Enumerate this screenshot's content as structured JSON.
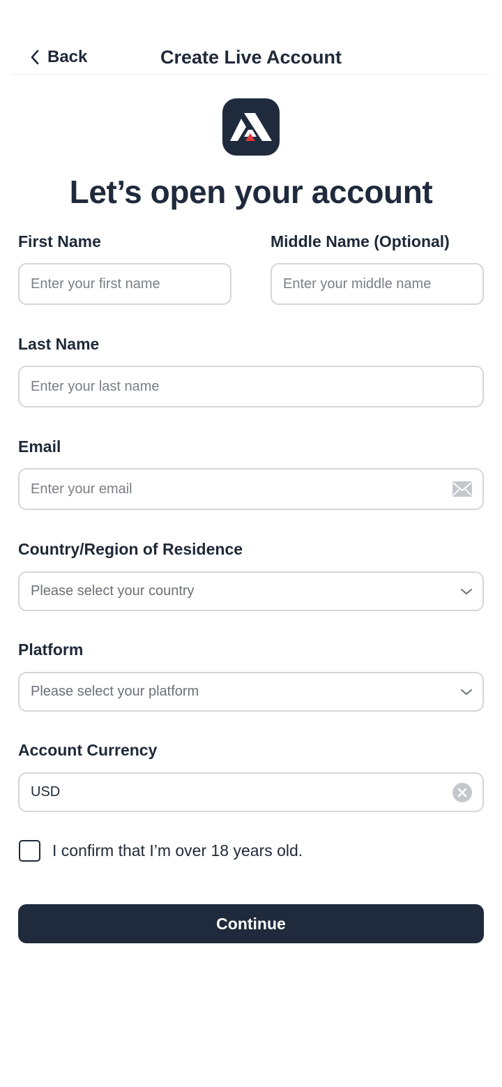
{
  "header": {
    "back_label": "Back",
    "title": "Create Live Account"
  },
  "app_icon": "triangle-logo-icon",
  "headline": "Let’s open your account",
  "form": {
    "first_name": {
      "label": "First Name",
      "placeholder": "Enter your first name"
    },
    "middle_name": {
      "label": "Middle Name (Optional)",
      "placeholder": "Enter your middle name"
    },
    "last_name": {
      "label": "Last Name",
      "placeholder": "Enter your last name"
    },
    "email": {
      "label": "Email",
      "placeholder": "Enter your email",
      "icon": "envelope-icon"
    },
    "country": {
      "label": "Country/Region of Residence",
      "placeholder": "Please select your country",
      "icon": "chevron-down-icon"
    },
    "platform": {
      "label": "Platform",
      "placeholder": "Please select your platform",
      "icon": "chevron-down-icon"
    },
    "currency": {
      "label": "Account Currency",
      "value": "USD",
      "icon": "clear-icon"
    },
    "age_confirm": {
      "label": "I confirm that I’m over 18 years old.",
      "checked": false
    }
  },
  "continue_label": "Continue",
  "colors": {
    "primary": "#1f2a3c",
    "accent_red": "#e03a3a",
    "border": "#d3d6da",
    "placeholder": "#7a7f86"
  }
}
